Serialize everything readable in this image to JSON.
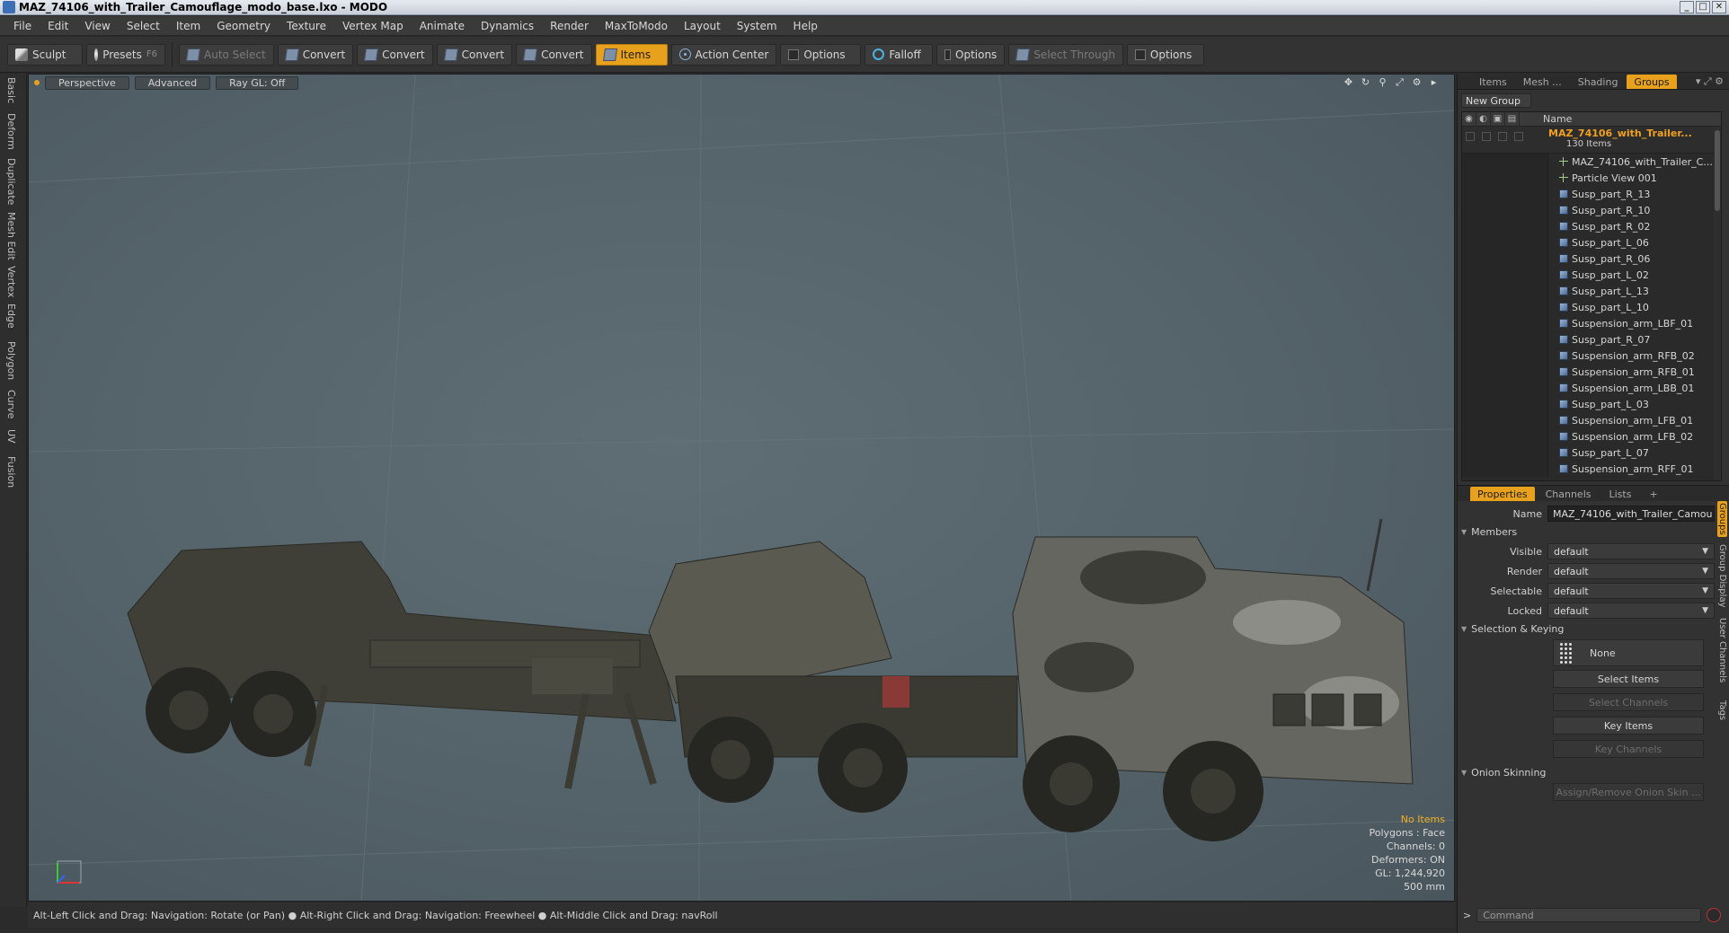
{
  "window": {
    "title": "MAZ_74106_with_Trailer_Camouflage_modo_base.lxo - MODO",
    "buttons": {
      "minimize": "_",
      "maximize": "□",
      "close": "✕"
    }
  },
  "menu": [
    "File",
    "Edit",
    "View",
    "Select",
    "Item",
    "Geometry",
    "Texture",
    "Vertex Map",
    "Animate",
    "Dynamics",
    "Render",
    "MaxToModo",
    "Layout",
    "System",
    "Help"
  ],
  "toolbar": {
    "sculpt": "Sculpt",
    "presets": "Presets",
    "presets_hotkey": "F6",
    "auto_select": "Auto Select",
    "convert1": "Convert",
    "convert2": "Convert",
    "convert3": "Convert",
    "convert4": "Convert",
    "items": "Items",
    "action_center": "Action Center",
    "options1": "Options",
    "falloff": "Falloff",
    "options2": "Options",
    "select_through": "Select Through",
    "options3": "Options"
  },
  "left_tabs": [
    "Basic",
    "Deform",
    "Duplicate",
    "Mesh Edit",
    "Vertex",
    "Edge",
    "Polygon",
    "Curve",
    "UV",
    "Fusion"
  ],
  "viewport": {
    "tabs": {
      "perspective": "Perspective",
      "advanced": "Advanced",
      "raygl": "Ray GL: Off"
    },
    "info": {
      "no_items": "No Items",
      "polygons": "Polygons : Face",
      "channels": "Channels: 0",
      "deformers": "Deformers: ON",
      "gl": "GL: 1,244,920",
      "scale": "500 mm"
    },
    "colors": {
      "background": "#56636a",
      "warning": "#f0b020",
      "accent": "#e8a11d"
    }
  },
  "statusbar": "Alt-Left Click and Drag: Navigation: Rotate (or Pan) ● Alt-Right Click and Drag: Navigation: Freewheel ● Alt-Middle Click and Drag: navRoll",
  "right_panel": {
    "tabs": {
      "items": "Items",
      "mesh": "Mesh ...",
      "shading": "Shading",
      "groups": "Groups"
    },
    "new_group": "New Group",
    "column_name": "Name",
    "group": {
      "name": "MAZ_74106_with_Trailer...",
      "count": "130 Items"
    },
    "members": [
      "MAZ_74106_with_Trailer_C...",
      "Particle View 001",
      "Susp_part_R_13",
      "Susp_part_R_10",
      "Susp_part_R_02",
      "Susp_part_L_06",
      "Susp_part_R_06",
      "Susp_part_L_02",
      "Susp_part_L_13",
      "Susp_part_L_10",
      "Suspension_arm_LBF_01",
      "Susp_part_R_07",
      "Suspension_arm_RFB_02",
      "Suspension_arm_RFB_01",
      "Suspension_arm_LBB_01",
      "Susp_part_L_03",
      "Suspension_arm_LFB_01",
      "Suspension_arm_LFB_02",
      "Susp_part_L_07",
      "Suspension_arm_RFF_01"
    ],
    "prop_tabs": {
      "properties": "Properties",
      "channels": "Channels",
      "lists": "Lists",
      "add": "+"
    },
    "props": {
      "name_label": "Name",
      "name_value": "MAZ_74106_with_Trailer_Camou",
      "members_section": "Members",
      "visible_label": "Visible",
      "visible_value": "default",
      "render_label": "Render",
      "render_value": "default",
      "selectable_label": "Selectable",
      "selectable_value": "default",
      "locked_label": "Locked",
      "locked_value": "default",
      "sel_keying_section": "Selection & Keying",
      "none_btn": "None",
      "select_items": "Select Items",
      "select_channels": "Select Channels",
      "key_items": "Key Items",
      "key_channels": "Key Channels",
      "onion_section": "Onion Skinning",
      "assign_onion": "Assign/Remove Onion Skin ..."
    },
    "side_tabs": [
      "Groups",
      "Group Display",
      "User Channels",
      "Tags"
    ],
    "command_prompt": ">",
    "command_placeholder": "Command"
  }
}
